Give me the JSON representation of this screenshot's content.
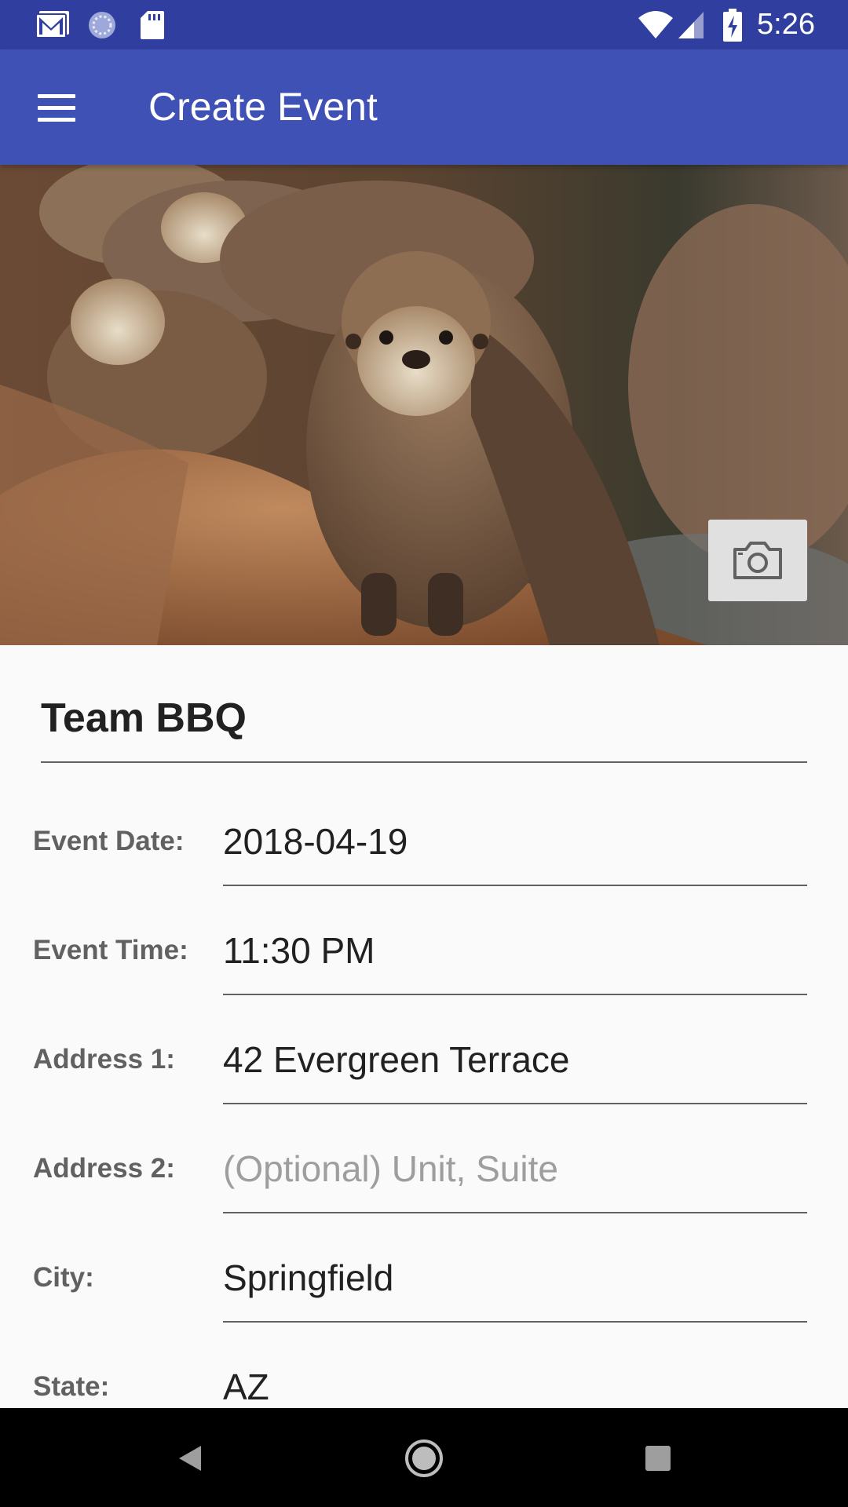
{
  "status_bar": {
    "time": "5:26",
    "left_icons": [
      "gmail-icon",
      "sync-icon",
      "sd-card-icon"
    ],
    "right_icons": [
      "wifi-icon",
      "signal-icon",
      "battery-charging-icon"
    ]
  },
  "app_bar": {
    "title": "Create Event",
    "menu_icon": "hamburger-menu-icon"
  },
  "hero": {
    "image": "otters-photo",
    "camera_button_icon": "camera-icon"
  },
  "form": {
    "event_name": "Team BBQ",
    "fields": [
      {
        "label": "Event Date:",
        "value": "2018-04-19",
        "placeholder": ""
      },
      {
        "label": "Event Time:",
        "value": "11:30 PM",
        "placeholder": ""
      },
      {
        "label": "Address 1:",
        "value": "42 Evergreen Terrace",
        "placeholder": ""
      },
      {
        "label": "Address 2:",
        "value": "",
        "placeholder": "(Optional) Unit, Suite"
      },
      {
        "label": "City:",
        "value": "Springfield",
        "placeholder": ""
      },
      {
        "label": "State:",
        "value": "AZ",
        "placeholder": ""
      }
    ]
  },
  "nav_bar": {
    "buttons": [
      "back-icon",
      "home-icon",
      "recents-icon"
    ]
  },
  "colors": {
    "status_bar": "#303f9f",
    "app_bar": "#3f51b5",
    "background": "#fafafa",
    "underline": "#616161"
  }
}
